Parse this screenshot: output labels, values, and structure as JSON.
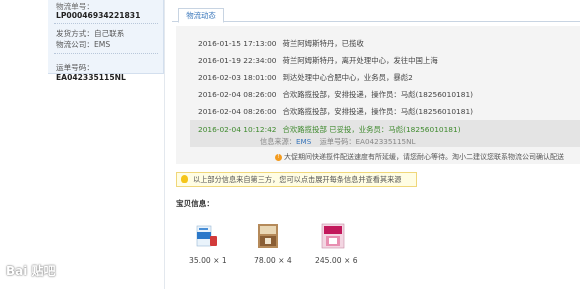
{
  "order_panel": {
    "tracking_label": "物流单号：",
    "tracking_value": "LP00046934221831",
    "ship_method": "发货方式：自己联系",
    "carrier": "物流公司：EMS",
    "waybill_label": "运单号码：",
    "waybill_value": "EA042335115NL"
  },
  "tabs": {
    "logistics": "物流动态"
  },
  "log": [
    {
      "time": "2016-01-15 17:13:00",
      "text": "荷兰阿姆斯特丹，已揽收"
    },
    {
      "time": "2016-01-19 22:34:00",
      "text": "荷兰阿姆斯特丹，离开处理中心，发往中国上海"
    },
    {
      "time": "2016-02-03 18:01:00",
      "text": "到达处理中心合肥中心，业务员，暴彪2"
    },
    {
      "time": "2016-02-04 08:26:00",
      "text": "合欢路揽投部，安排投递，操作员：马彪(18256010181)"
    },
    {
      "time": "2016-02-04 08:26:00",
      "text": "合欢路揽投部，安排投递，操作员：马彪(18256010181)"
    }
  ],
  "latest": {
    "time": "2016-02-04 10:12:42",
    "text": "合欢路揽投部 已妥投，业务员：马彪(18256010181)",
    "source_label": "信息来源：",
    "source_carrier": "EMS",
    "waybill_label": "运单号码：",
    "waybill_value": "EA042335115NL",
    "notice": "大促期间快递揽件配送速度有所延缓，请您耐心等待。淘小二建议您联系物流公司确认配送"
  },
  "info_bar": {
    "text": "以上部分信息来自第三方，您可以点击展开每条信息并查看其来源"
  },
  "products_section": {
    "title": "宝贝信息：",
    "items": [
      {
        "price": "35.00 × 1",
        "image_icon": "product-box-blue-icon"
      },
      {
        "price": "78.00 × 4",
        "image_icon": "product-box-tan-icon"
      },
      {
        "price": "245.00 × 6",
        "image_icon": "product-box-pink-icon"
      }
    ]
  },
  "watermark": "Bai 贴吧",
  "colors": {
    "accent": "#3a77bb",
    "success": "#3f8a2e",
    "warning": "#f39b1f"
  }
}
